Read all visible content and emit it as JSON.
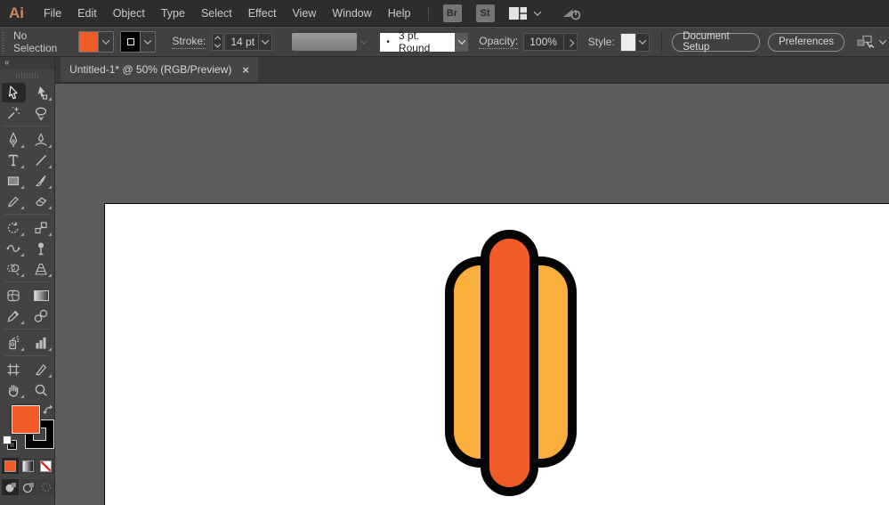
{
  "app": {
    "logo": "Ai"
  },
  "menu_bar": {
    "items": [
      "File",
      "Edit",
      "Object",
      "Type",
      "Select",
      "Effect",
      "View",
      "Window",
      "Help"
    ],
    "bridge_label": "Br",
    "stock_label": "St"
  },
  "control_bar": {
    "selection_status": "No Selection",
    "stroke_label": "Stroke:",
    "stroke_weight": "14 pt",
    "brush_bullet": "•",
    "brush_name": "3 pt. Round",
    "opacity_label": "Opacity:",
    "opacity_value": "100%",
    "style_label": "Style:",
    "document_setup_label": "Document Setup",
    "preferences_label": "Preferences",
    "fill_color": "#F15B25",
    "stroke_color": "#000000"
  },
  "tab_bar": {
    "title": "Untitled-1* @ 50% (RGB/Preview)",
    "close_glyph": "×"
  },
  "toolbar": {
    "collapse_glyph": "«",
    "active_tool": "selection",
    "tools": [
      "selection",
      "direct-selection",
      "magic-wand",
      "lasso",
      "pen",
      "curvature",
      "type",
      "line-segment",
      "rectangle",
      "paintbrush",
      "pencil",
      "eraser",
      "rotate",
      "scale",
      "width",
      "puppet-warp",
      "shape-builder",
      "perspective-grid",
      "mesh",
      "gradient",
      "eyedropper",
      "blend",
      "symbol-sprayer",
      "column-graph",
      "artboard",
      "slice",
      "hand",
      "zoom"
    ],
    "fill_color": "#F15B25",
    "stroke_color": "#000000"
  },
  "canvas": {
    "background": "#5C5C5C",
    "artboard_color": "#FFFFFF",
    "artwork": {
      "subject": "hot dog icon",
      "bun_fill": "#FAAE3C",
      "sausage_fill": "#F15B25",
      "outline_color": "#000000"
    }
  }
}
